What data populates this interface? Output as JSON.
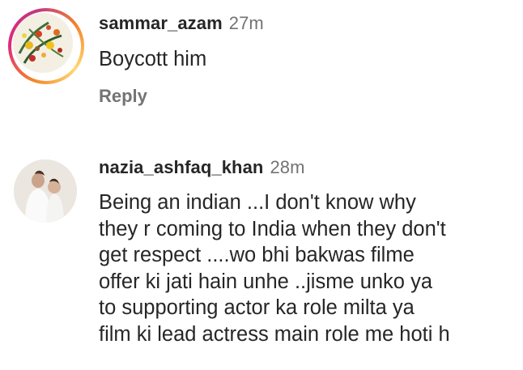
{
  "comments": [
    {
      "username": "sammar_azam",
      "time": "27m",
      "text": "Boycott him",
      "reply_label": "Reply",
      "has_story_ring": true
    },
    {
      "username": "nazia_ashfaq_khan",
      "time": "28m",
      "text": "Being an indian ...I don't know why\nthey r coming to India when they don't\nget respect ....wo bhi bakwas filme\noffer ki jati hain unhe ..jisme unko ya\nto supporting actor ka role milta ya\nfilm ki lead actress main role me hoti h",
      "has_story_ring": false
    }
  ],
  "colors": {
    "text": "#262626",
    "secondary": "#737373",
    "story_ring_start": "#f58529",
    "story_ring_end": "#dd2a7b"
  }
}
